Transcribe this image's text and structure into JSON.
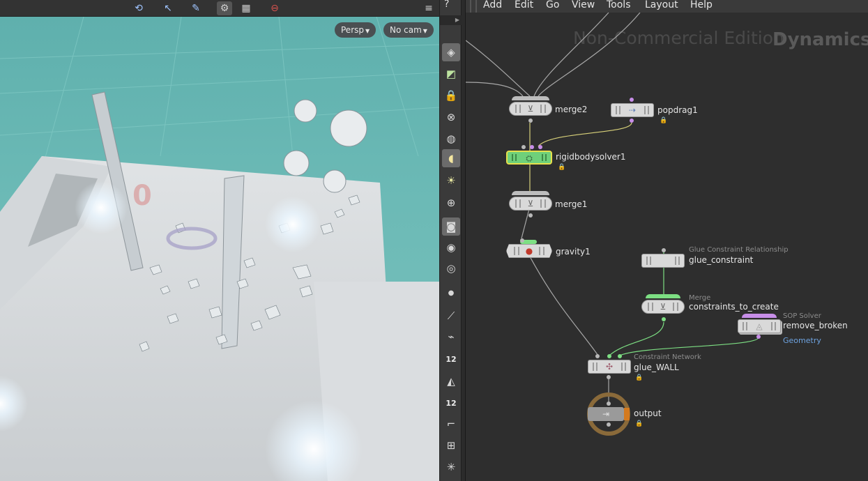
{
  "viewport": {
    "camera_view": "Persp",
    "camera_object": "No cam",
    "toolbar_icons": [
      "select-icon",
      "handle-icon",
      "paint-icon",
      "snap-icon",
      "grid-icon",
      "stop-icon",
      "display-options-icon",
      "help-icon"
    ]
  },
  "shelf": {
    "icons": [
      "wireframe-icon",
      "ghost-icon",
      "lock-icon",
      "camera-icon",
      "sphere-icon",
      "light-icon",
      "bulb-icon",
      "target-icon",
      "checker-icon",
      "eye-icon",
      "eye-lock-icon",
      "dot-icon",
      "brush-icon",
      "probe-icon",
      "number-icon",
      "eraser-icon",
      "number-icon",
      "angle-icon",
      "transform-icon",
      "pivot-icon"
    ],
    "numbers": [
      "12",
      "12"
    ]
  },
  "menubar": {
    "items": [
      "Add",
      "Edit",
      "Go",
      "View",
      "Tools",
      "Layout",
      "Help"
    ]
  },
  "network": {
    "watermark": "Non-Commercial Edition",
    "context": "Dynamics",
    "nodes": {
      "merge2": {
        "label": "merge2"
      },
      "popdrag1": {
        "label": "popdrag1"
      },
      "rigidbodysolver1": {
        "label": "rigidbodysolver1"
      },
      "merge1": {
        "label": "merge1"
      },
      "gravity1": {
        "label": "gravity1"
      },
      "glue_constraint": {
        "type": "Glue Constraint Relationship",
        "label": "glue_constraint"
      },
      "constraints_to_create": {
        "type": "Merge",
        "label": "constraints_to_create"
      },
      "remove_broken": {
        "type": "SOP Solver",
        "label": "remove_broken",
        "sub": "Geometry"
      },
      "glue_wall": {
        "type": "Constraint Network",
        "label": "glue_WALL"
      },
      "output": {
        "label": "output"
      }
    }
  },
  "colors": {
    "viewport_bg": "#6cbab6",
    "solver_node": "#6fd07a",
    "selection_outline": "#e7e04b",
    "purple_port": "#c78ee8",
    "output_flag": "#d47a1f"
  }
}
